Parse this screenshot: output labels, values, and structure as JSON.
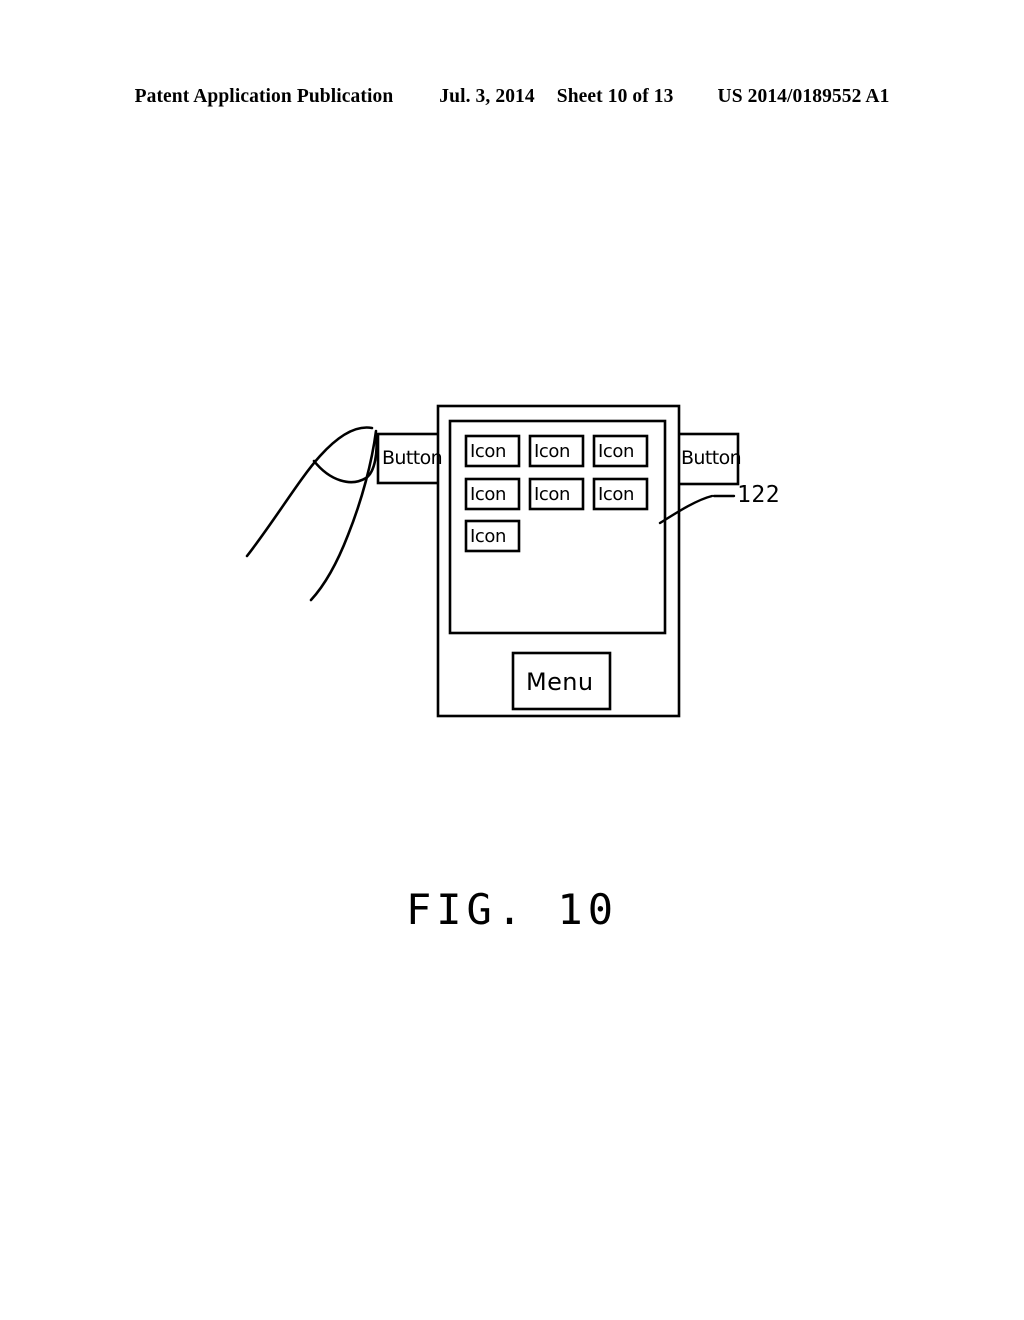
{
  "header": {
    "publication": "Patent Application Publication",
    "date": "Jul. 3, 2014",
    "sheet": "Sheet 10 of 13",
    "number": "US 2014/0189552 A1"
  },
  "figure": {
    "caption": "FIG. 10",
    "reference_numeral": "122",
    "colors": {
      "stroke": "#000000",
      "background": "#ffffff"
    },
    "device": {
      "left_button_label": "Button",
      "right_button_label": "Button",
      "menu_button_label": "Menu",
      "screen": {
        "icons": [
          {
            "label": "Icon",
            "row": 1,
            "col": 1
          },
          {
            "label": "Icon",
            "row": 1,
            "col": 2
          },
          {
            "label": "Icon",
            "row": 1,
            "col": 3
          },
          {
            "label": "Icon",
            "row": 2,
            "col": 1
          },
          {
            "label": "Icon",
            "row": 2,
            "col": 2
          },
          {
            "label": "Icon",
            "row": 2,
            "col": 3
          },
          {
            "label": "Icon",
            "row": 3,
            "col": 1
          }
        ],
        "icon_count": 7,
        "rows": 3,
        "columns": 3
      }
    },
    "hand": {
      "gesture": "pointing-finger",
      "target": "left-button"
    }
  }
}
